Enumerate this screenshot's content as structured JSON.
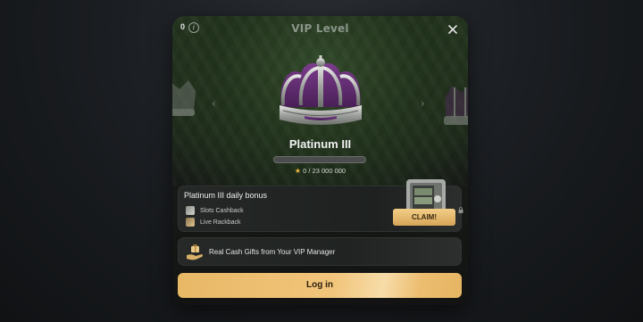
{
  "modal": {
    "title": "VIP Level",
    "count": "0",
    "info_icon": "info-icon",
    "close_icon": "close-icon"
  },
  "level": {
    "name": "Platinum III",
    "progress_fraction": 0,
    "points": "0 / 23 000 000",
    "points_icon": "star-icon"
  },
  "bonus": {
    "title": "Platinum III daily bonus",
    "items": [
      {
        "label": "Slots Cashback",
        "icon": "coins-icon"
      },
      {
        "label": "Live Rackback",
        "icon": "chips-icon"
      }
    ],
    "claim_label": "CLAIM!",
    "image_icon": "safe-icon",
    "lock_icon": "lock-icon"
  },
  "vip_manager": {
    "text": "Real Cash Gifts from Your VIP Manager",
    "icon": "hand-gift-icon"
  },
  "login_label": "Log in",
  "colors": {
    "accent_gold": "#e8b866",
    "crown_purple": "#5b2a6b",
    "background": "#1b1e22"
  }
}
